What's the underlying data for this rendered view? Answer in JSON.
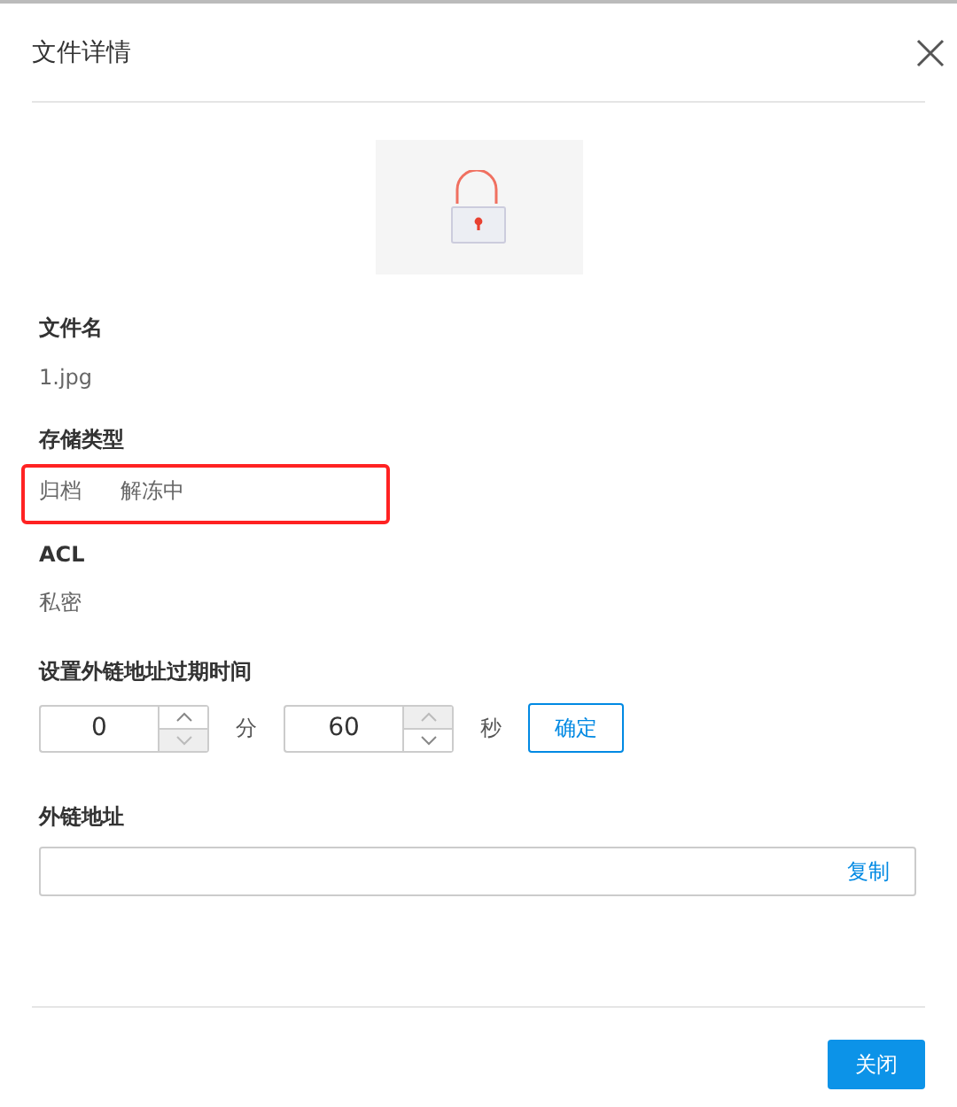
{
  "dialog": {
    "title": "文件详情"
  },
  "fields": [
    {
      "label": "文件名",
      "values": [
        "1.jpg"
      ],
      "highlighted": false
    },
    {
      "label": "存储类型",
      "values": [
        "归档",
        "解冻中"
      ],
      "highlighted": true
    },
    {
      "label": "ACL",
      "values": [
        "私密"
      ],
      "highlighted": false
    }
  ],
  "expiry": {
    "label": "设置外链地址过期时间",
    "spinners": [
      {
        "value": "0",
        "unit": "分",
        "up_disabled": false,
        "down_disabled": true
      },
      {
        "value": "60",
        "unit": "秒",
        "up_disabled": true,
        "down_disabled": false
      }
    ],
    "confirm": "确定"
  },
  "link": {
    "label": "外链地址",
    "copy": "复制"
  },
  "footer": {
    "close": "关闭"
  }
}
